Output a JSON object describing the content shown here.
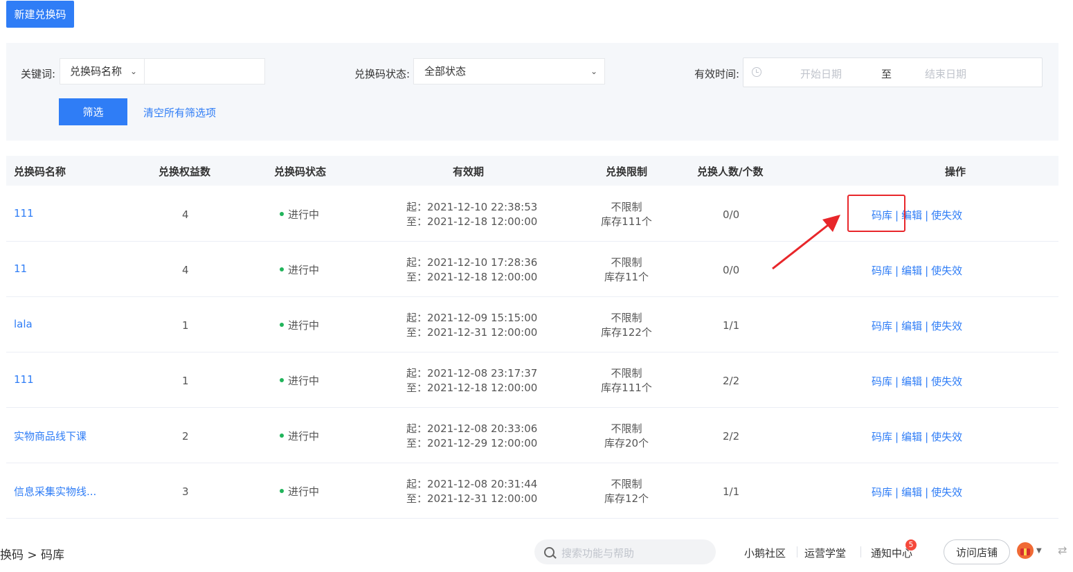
{
  "toolbar": {
    "new_button": "新建兑换码"
  },
  "filters": {
    "keyword_label": "关键词:",
    "keyword_type": "兑换码名称",
    "keyword_value": "",
    "status_label": "兑换码状态:",
    "status_value": "全部状态",
    "time_label": "有效时间:",
    "start_placeholder": "开始日期",
    "range_separator": "至",
    "end_placeholder": "结束日期",
    "filter_button": "筛选",
    "clear_link": "清空所有筛选项"
  },
  "table": {
    "headers": [
      "兑换码名称",
      "兑换权益数",
      "兑换码状态",
      "有效期",
      "兑换限制",
      "兑换人数/个数",
      "操作"
    ],
    "rows": [
      {
        "name": "111",
        "benefits": "4",
        "status": "进行中",
        "start": "起：2021-12-10 22:38:53",
        "end": "至：2021-12-18 12:00:00",
        "limit": "不限制",
        "stock": "库存111个",
        "count": "0/0"
      },
      {
        "name": "11",
        "benefits": "4",
        "status": "进行中",
        "start": "起：2021-12-10 17:28:36",
        "end": "至：2021-12-18 12:00:00",
        "limit": "不限制",
        "stock": "库存11个",
        "count": "0/0"
      },
      {
        "name": "lala",
        "benefits": "1",
        "status": "进行中",
        "start": "起：2021-12-09 15:15:00",
        "end": "至：2021-12-31 12:00:00",
        "limit": "不限制",
        "stock": "库存122个",
        "count": "1/1"
      },
      {
        "name": "111",
        "benefits": "1",
        "status": "进行中",
        "start": "起：2021-12-08 23:17:37",
        "end": "至：2021-12-18 12:00:00",
        "limit": "不限制",
        "stock": "库存111个",
        "count": "2/2"
      },
      {
        "name": "实物商品线下课",
        "benefits": "2",
        "status": "进行中",
        "start": "起：2021-12-08 20:33:06",
        "end": "至：2021-12-29 12:00:00",
        "limit": "不限制",
        "stock": "库存20个",
        "count": "2/2"
      },
      {
        "name": "信息采集实物线...",
        "benefits": "3",
        "status": "进行中",
        "start": "起：2021-12-08 20:31:44",
        "end": "至：2021-12-31 12:00:00",
        "limit": "不限制",
        "stock": "库存12个",
        "count": "1/1"
      }
    ],
    "actions": {
      "codes": "码库",
      "edit": "编辑",
      "invalidate": "使失效",
      "separator": "|"
    }
  },
  "bottom_bar": {
    "breadcrumb": "换码 > 码库",
    "search_placeholder": "搜索功能与帮助",
    "community": "小鹅社区",
    "academy": "运营学堂",
    "notifications": "通知中心",
    "notification_count": "5",
    "visit_store": "访问店铺"
  },
  "icons": {
    "clock": "clock-icon",
    "search": "search-icon",
    "gift": "gift-icon",
    "switch": "switch-icon"
  },
  "colors": {
    "primary": "#2f7df6",
    "status_green": "#21b45b",
    "annotation_red": "#e8262a",
    "badge_red": "#f5483b"
  }
}
